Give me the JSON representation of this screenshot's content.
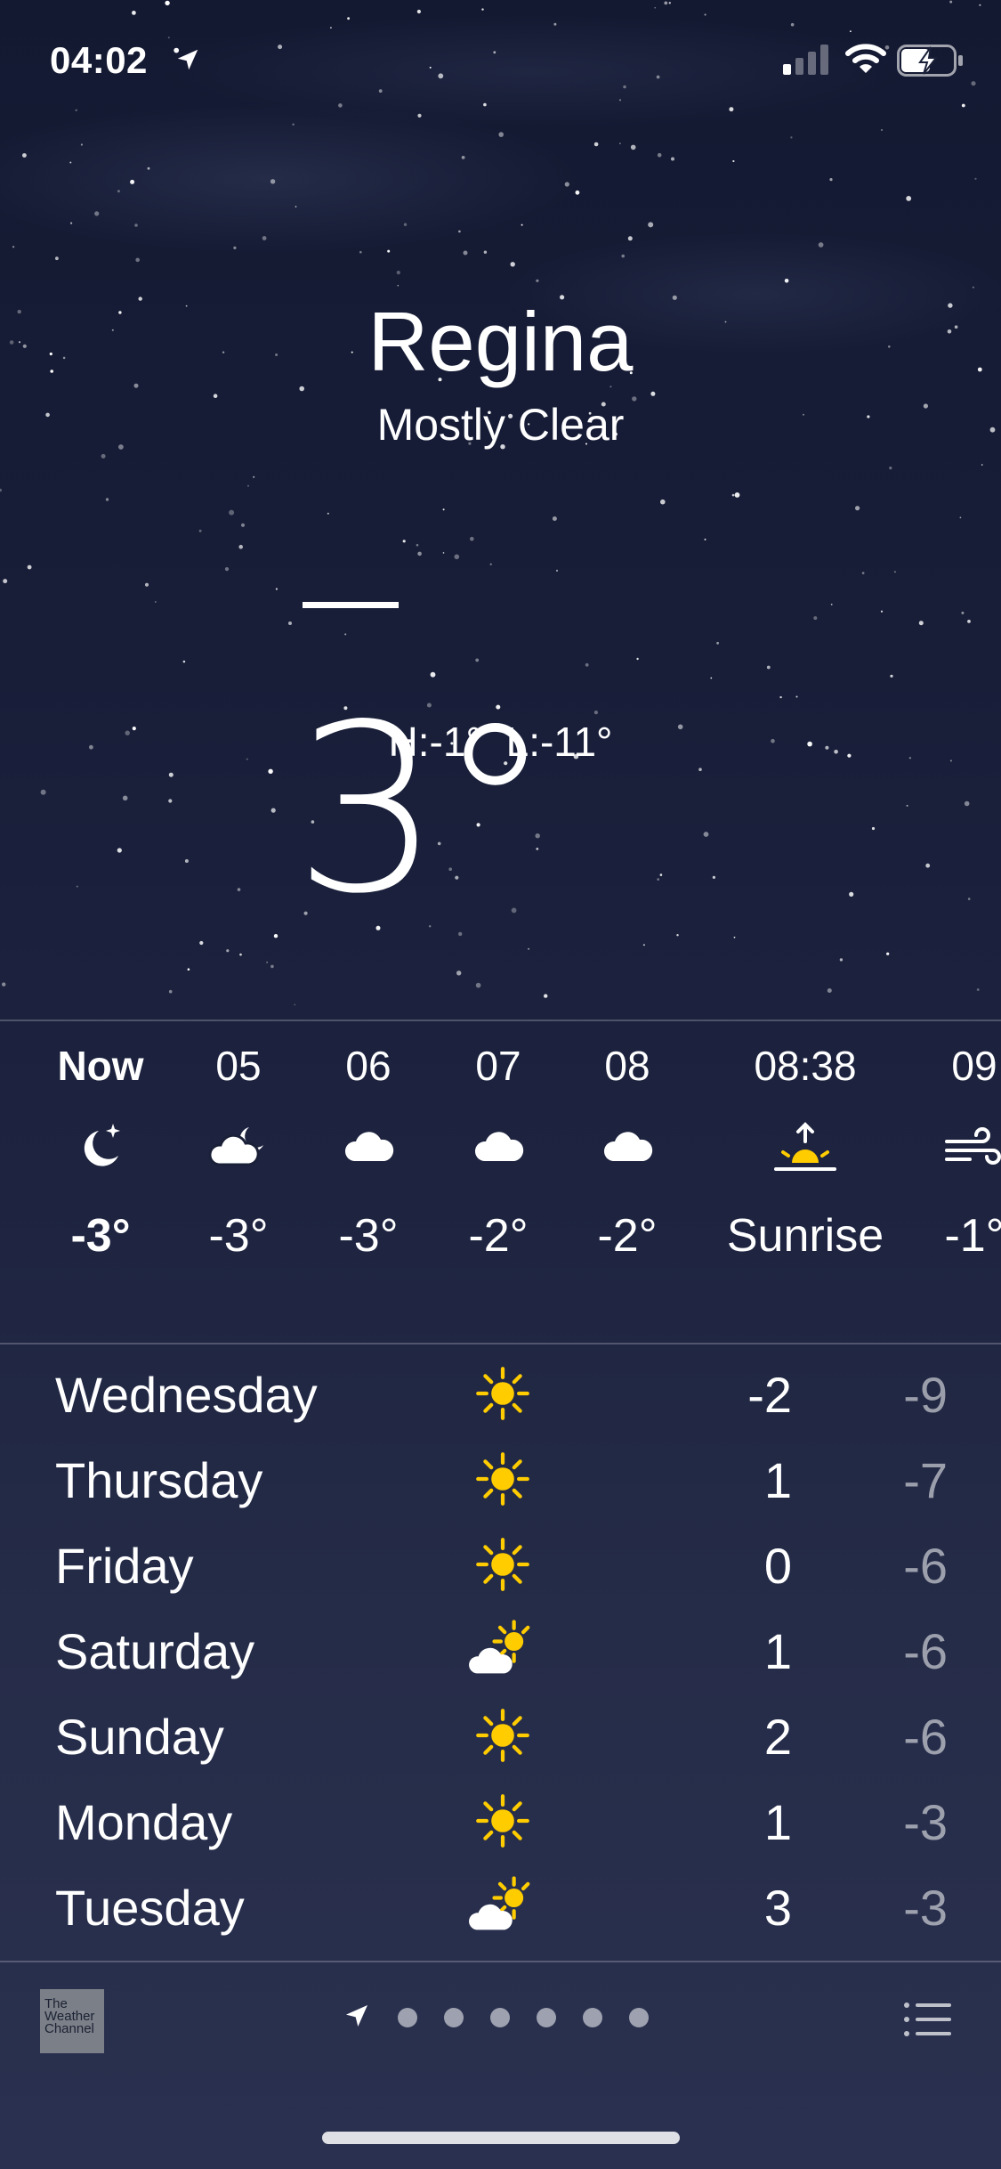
{
  "status_bar": {
    "time": "04:02",
    "icons": [
      "location-arrow-icon",
      "cellular-signal-icon",
      "wifi-icon",
      "battery-charging-icon"
    ]
  },
  "header": {
    "city": "Regina",
    "condition": "Mostly Clear",
    "temperature": "3°",
    "temperature_sign": "−",
    "hi_lo": "H:-1°  L:-11°"
  },
  "hourly": [
    {
      "time": "Now",
      "icon": "moon-stars-icon",
      "temp": "-3°",
      "bold": true
    },
    {
      "time": "05",
      "icon": "cloud-moon-icon",
      "temp": "-3°"
    },
    {
      "time": "06",
      "icon": "cloud-icon",
      "temp": "-3°"
    },
    {
      "time": "07",
      "icon": "cloud-icon",
      "temp": "-2°"
    },
    {
      "time": "08",
      "icon": "cloud-icon",
      "temp": "-2°"
    },
    {
      "time": "08:38",
      "icon": "sunrise-icon",
      "temp": "Sunrise"
    },
    {
      "time": "09",
      "icon": "wind-icon",
      "temp": "-1°"
    }
  ],
  "daily": [
    {
      "day": "Wednesday",
      "icon": "sun-icon",
      "high": "-2",
      "low": "-9"
    },
    {
      "day": "Thursday",
      "icon": "sun-icon",
      "high": "1",
      "low": "-7"
    },
    {
      "day": "Friday",
      "icon": "sun-icon",
      "high": "0",
      "low": "-6"
    },
    {
      "day": "Saturday",
      "icon": "partly-cloudy-icon",
      "high": "1",
      "low": "-6"
    },
    {
      "day": "Sunday",
      "icon": "sun-icon",
      "high": "2",
      "low": "-6"
    },
    {
      "day": "Monday",
      "icon": "sun-icon",
      "high": "1",
      "low": "-3"
    },
    {
      "day": "Tuesday",
      "icon": "partly-cloudy-icon",
      "high": "3",
      "low": "-3"
    }
  ],
  "toolbar": {
    "logo_text": "The Weather Channel",
    "page_count": 6,
    "icons": [
      "weather-channel-logo",
      "location-arrow-icon",
      "list-icon"
    ]
  },
  "colors": {
    "sun": "#FFCC00",
    "background_top": "#141932",
    "background_bottom": "#2a3150"
  }
}
